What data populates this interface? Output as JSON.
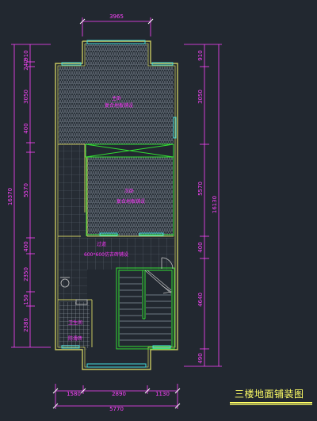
{
  "drawing": {
    "title": "三楼地面铺装图"
  },
  "dimensions": {
    "top": [
      "3965"
    ],
    "bottom_segments": [
      "1580",
      "2890",
      "1130"
    ],
    "bottom_total": "5770",
    "left_segments": [
      "910",
      "240",
      "3050",
      "400",
      "5570",
      "400",
      "2350",
      "150",
      "2380"
    ],
    "left_total": "16370",
    "right_segments": [
      "910",
      "3050",
      "5570",
      "400",
      "4640",
      "490"
    ],
    "right_total": "16130"
  },
  "rooms": {
    "master_bedroom": {
      "name": "主卧",
      "finish": "复合地板铺设"
    },
    "second_bedroom": {
      "name": "次卧",
      "finish": "复合地板铺设"
    },
    "corridor": {
      "name": "过道",
      "finish": "600*600仿古砖铺设"
    },
    "bathroom": {
      "name": "卫生间",
      "finish": "防滑砖"
    }
  },
  "colors": {
    "background": "#222830",
    "walls": "#c8c860",
    "dimension_lines": "#ff44ff",
    "labels": "#ff33ff",
    "green_lines": "#33dd33",
    "windows": "#44dddd",
    "hatch": "#8a96a2",
    "title": "#ffff66"
  }
}
